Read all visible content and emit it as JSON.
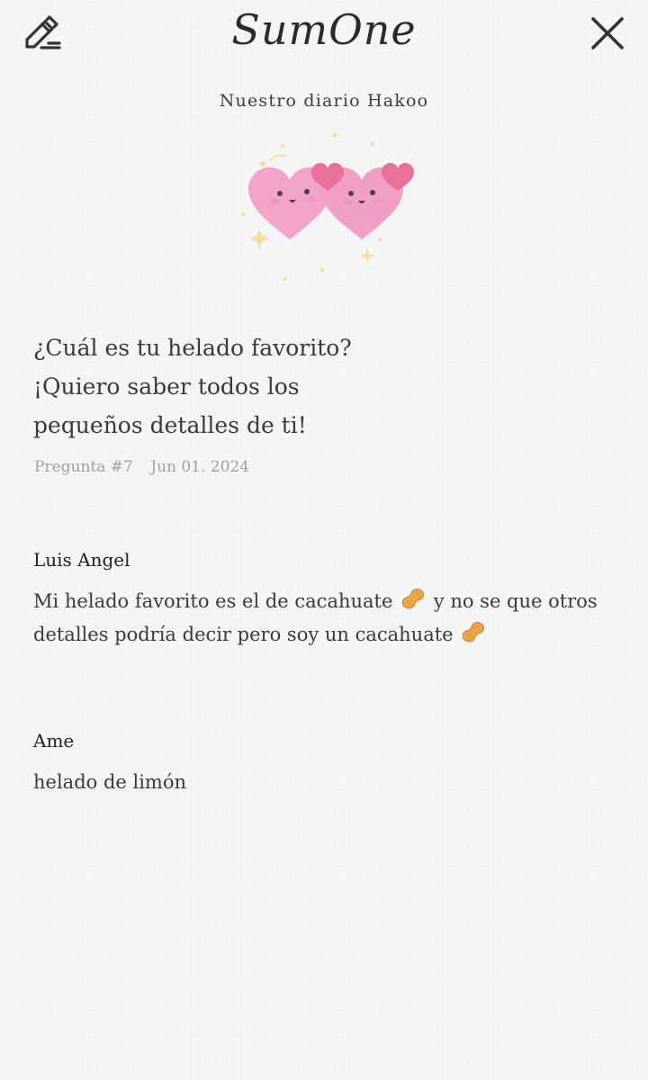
{
  "header": {
    "app_title": "SumOne",
    "edit_icon": "edit-pencil-icon",
    "close_icon": "close-icon"
  },
  "diary": {
    "name": "Nuestro diario Hakoo"
  },
  "question": {
    "lines": [
      "¿Cuál es tu helado favorito?",
      "¡Quiero saber todos los",
      "pequeños detalles de ti!"
    ],
    "number": "Pregunta #7",
    "date": "Jun 01. 2024"
  },
  "answers": [
    {
      "name": "Luis Angel",
      "line1_a": "Mi helado favorito es el de cacahuate",
      "line1_b": "y no se que otros",
      "line2_a": "detalles podría decir pero soy un cacahuate",
      "emoji": "peanut-emoji"
    },
    {
      "name": "Ame",
      "text": "helado de limón"
    }
  ],
  "colors": {
    "background": "#f5f5f6",
    "heart_pink": "#f2a3c9",
    "small_heart": "#e8709a",
    "meta_gray": "#a0a0a0"
  }
}
